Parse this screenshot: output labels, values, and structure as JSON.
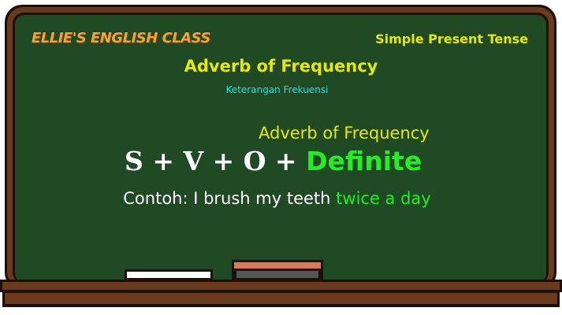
{
  "header": {
    "brand": "ELLIE'S ENGLISH CLASS",
    "topic": "Simple Present Tense"
  },
  "main": {
    "title": "Adverb of Frequency",
    "subtitle": "Keterangan Frekuensi",
    "formula_label": "Adverb of Frequency",
    "formula_base": "S + V + O + ",
    "formula_highlight": "Definite",
    "example_text": "Contoh: I brush my teeth ",
    "example_highlight": "twice a day"
  },
  "colors": {
    "board": "#1f4a23",
    "wood": "#6b3a1c",
    "yellow_text": "#e8e800",
    "cyan_text": "#1ee3f0",
    "green_highlight": "#22ee22",
    "brand_orange": "#f0a531"
  }
}
